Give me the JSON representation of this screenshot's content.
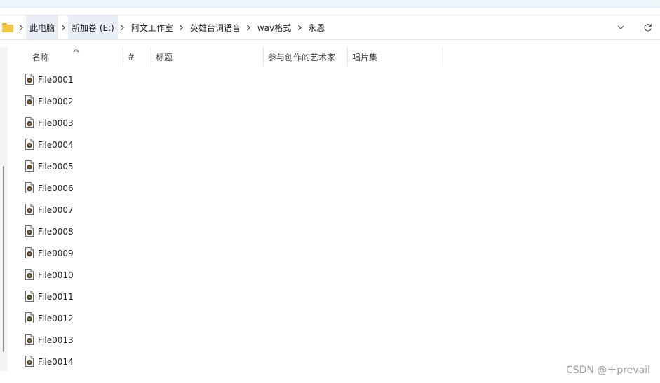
{
  "breadcrumb": [
    "此电脑",
    "新加卷 (E:)",
    "阿文工作室",
    "英雄台词语音",
    "wav格式",
    "永恩"
  ],
  "columns": {
    "name": "名称",
    "number": "#",
    "title": "标题",
    "artist": "参与创作的艺术家",
    "album": "唱片集"
  },
  "files": [
    "File0001",
    "File0002",
    "File0003",
    "File0004",
    "File0005",
    "File0006",
    "File0007",
    "File0008",
    "File0009",
    "File0010",
    "File0011",
    "File0012",
    "File0013",
    "File0014"
  ],
  "watermark": "CSDN @＋prevail",
  "colors": {
    "folder": "#f7c844",
    "crumb_highlight": "#e7eef6",
    "nav_pane": "#f3f3f3"
  }
}
